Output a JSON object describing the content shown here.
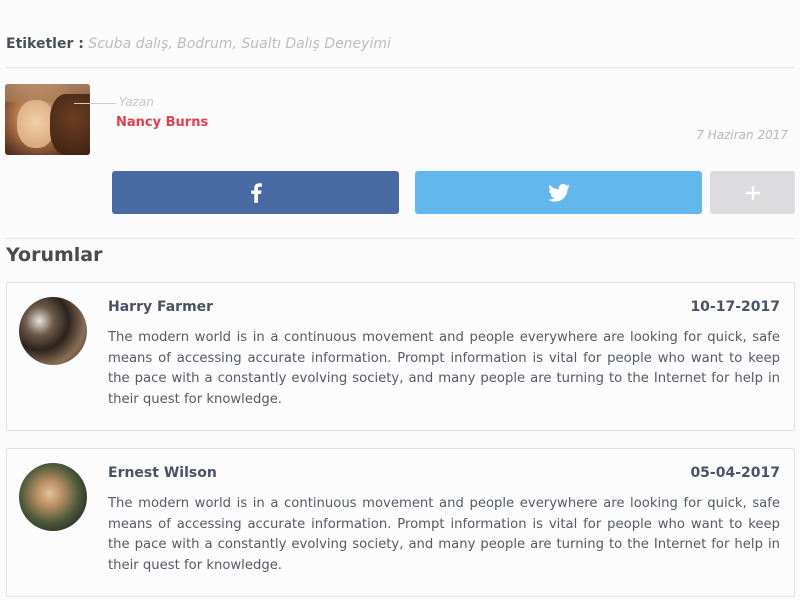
{
  "tags": {
    "label": "Etiketler :",
    "value": "Scuba dalış, Bodrum, Sualtı Dalış Deneyimi"
  },
  "author": {
    "role": "Yazan",
    "name": "Nancy Burns",
    "date": "7 Haziran 2017",
    "photo": "author-photo"
  },
  "share": {
    "buttons": [
      {
        "icon": "facebook-icon",
        "color": "#476aa3"
      },
      {
        "icon": "twitter-icon",
        "color": "#62b8ec"
      },
      {
        "icon": "plus-icon",
        "color": "#dcdcde"
      }
    ]
  },
  "comments": {
    "title": "Yorumlar",
    "items": [
      {
        "name": "Harry Farmer",
        "date": "10-17-2017",
        "text": "The modern world is in a continuous movement and people everywhere are looking for quick, safe means of accessing accurate information. Prompt information is vital for people who want to keep the pace with a constantly evolving society, and many people are turning to the Internet for help in their quest for knowledge."
      },
      {
        "name": "Ernest Wilson",
        "date": "05-04-2017",
        "text": "The modern world is in a continuous movement and people everywhere are looking for quick, safe means of accessing accurate information. Prompt information is vital for people who want to keep the pace with a constantly evolving society, and many people are turning to the Internet for help in their quest for knowledge."
      }
    ]
  },
  "colors": {
    "accent": "#e2404f",
    "facebook": "#476aa3",
    "twitter": "#62b8ec"
  }
}
